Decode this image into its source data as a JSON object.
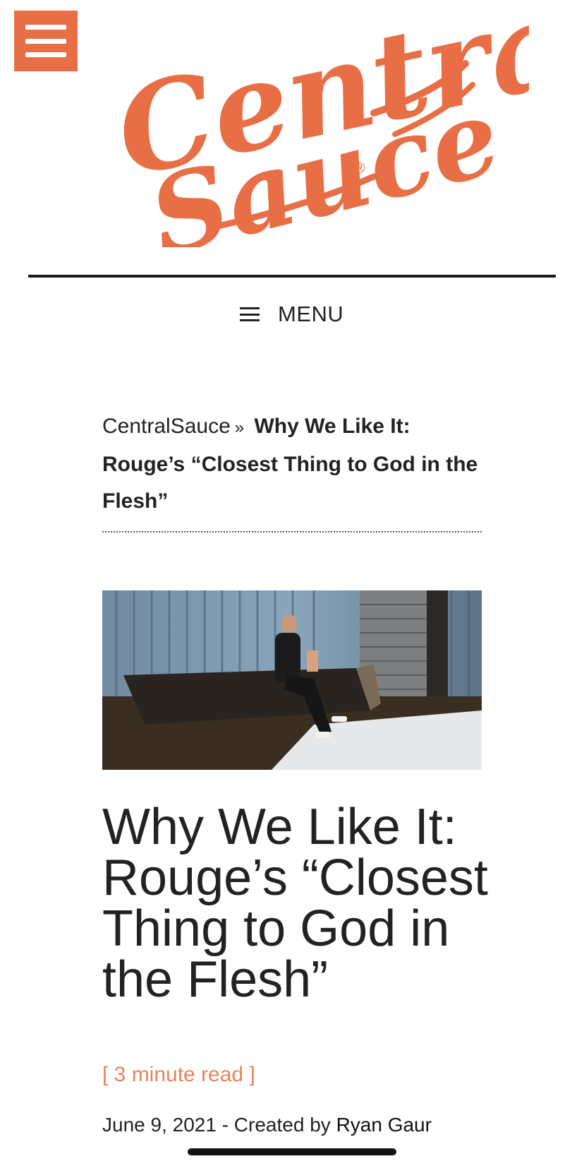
{
  "header": {
    "logo_text": [
      "Central",
      "Sauce"
    ],
    "logo_mark": "®",
    "brand_color": "#e86f45",
    "menu_icon": "hamburger-menu-icon",
    "menu_label": "MENU"
  },
  "breadcrumb": {
    "home": "CentralSauce",
    "separator": "»",
    "current": "Why We Like It: Rouge’s “Closest Thing to God in the Flesh”"
  },
  "article": {
    "title": "Why We Like It: Rouge’s “Closest Thing to God in the Flesh”",
    "read_time": "[ 3 minute read ]",
    "date": "June 9, 2021",
    "created_by_prefix": " - Created by ",
    "author": "Ryan Gaur"
  },
  "colors": {
    "accent": "#e86f45",
    "read_time": "#e8845a",
    "text": "#222222"
  }
}
